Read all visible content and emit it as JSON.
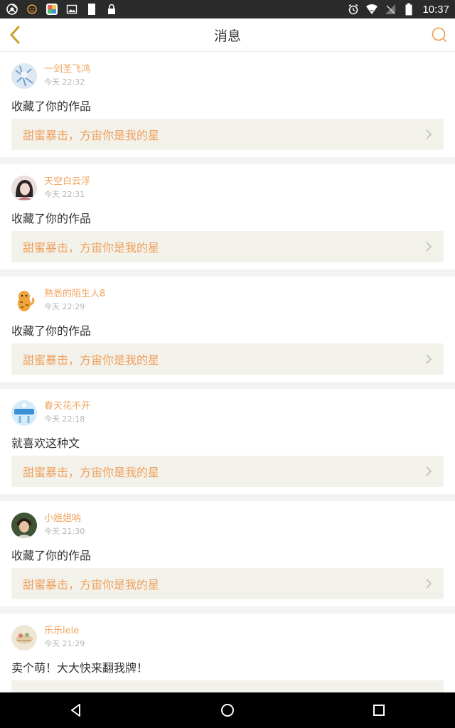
{
  "status_bar": {
    "time": "10:37",
    "left_icons": [
      "chrome-icon",
      "smiley-icon",
      "colorful-app-icon",
      "image-icon",
      "battery-full-icon",
      "lock-icon"
    ],
    "right_icons": [
      "alarm-icon",
      "wifi-icon",
      "no-signal-icon",
      "battery-icon"
    ]
  },
  "header": {
    "title": "消息",
    "back_icon": "back-chevron-icon",
    "search_icon": "search-icon"
  },
  "colors": {
    "accent": "#f0a35c",
    "link_bg": "#f3f2ea",
    "status_bar": "#2b2b2b"
  },
  "messages": [
    {
      "username": "一剑圣飞鸿",
      "time": "今天 22:32",
      "action": "收藏了你的作品",
      "work_title": "甜蜜暴击，方宙你是我的星",
      "avatar": "avatar-anime-blue"
    },
    {
      "username": "天空白云浮",
      "time": "今天 22:31",
      "action": "收藏了你的作品",
      "work_title": "甜蜜暴击，方宙你是我的星",
      "avatar": "avatar-girl-dark"
    },
    {
      "username": "熟悉的陌生人8",
      "time": "今天 22:29",
      "action": "收藏了你的作品",
      "work_title": "甜蜜暴击，方宙你是我的星",
      "avatar": "avatar-tiger"
    },
    {
      "username": "春天花不开",
      "time": "今天 22:18",
      "action": "就喜欢这种文",
      "work_title": "甜蜜暴击，方宙你是我的星",
      "avatar": "avatar-blue-badge"
    },
    {
      "username": "小姐姐呐",
      "time": "今天 21:30",
      "action": "收藏了你的作品",
      "work_title": "甜蜜暴击，方宙你是我的星",
      "avatar": "avatar-boy-green"
    },
    {
      "username": "乐乐lele",
      "time": "今天 21:29",
      "action": "卖个萌！大大快来翻我牌！",
      "work_title": "",
      "avatar": "avatar-pastel"
    }
  ],
  "nav_bar": {
    "icons": [
      "nav-back-icon",
      "nav-home-icon",
      "nav-recents-icon"
    ]
  }
}
